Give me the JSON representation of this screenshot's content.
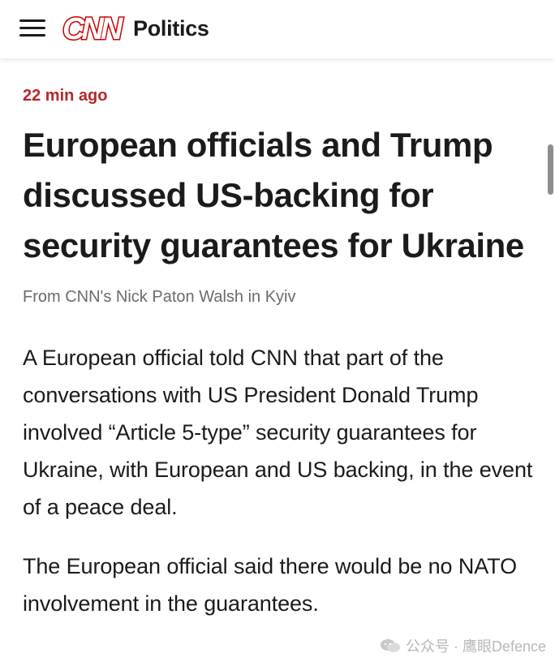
{
  "header": {
    "logo_text": "CNN",
    "section": "Politics",
    "menu_icon": "hamburger-menu-icon",
    "brand_color": "#cc0000"
  },
  "article": {
    "timestamp": "22 min ago",
    "headline": "European officials and Trump discussed US-backing for security guarantees for Ukraine",
    "byline": "From CNN's Nick Paton Walsh in Kyiv",
    "paragraphs": [
      "A European official told CNN that part of the conversations with US President Donald Trump involved “Article 5-type” security guarantees for Ukraine, with European and US backing, in the event of a peace deal.",
      "The European official said there would be no NATO involvement in the guarantees."
    ]
  },
  "watermark": {
    "text": "公众号 · 鹰眼Defence"
  },
  "colors": {
    "timestamp": "#b5272d",
    "headline": "#1b1b1b",
    "byline": "#6b6b6b",
    "body_text": "#1b1b1b"
  }
}
